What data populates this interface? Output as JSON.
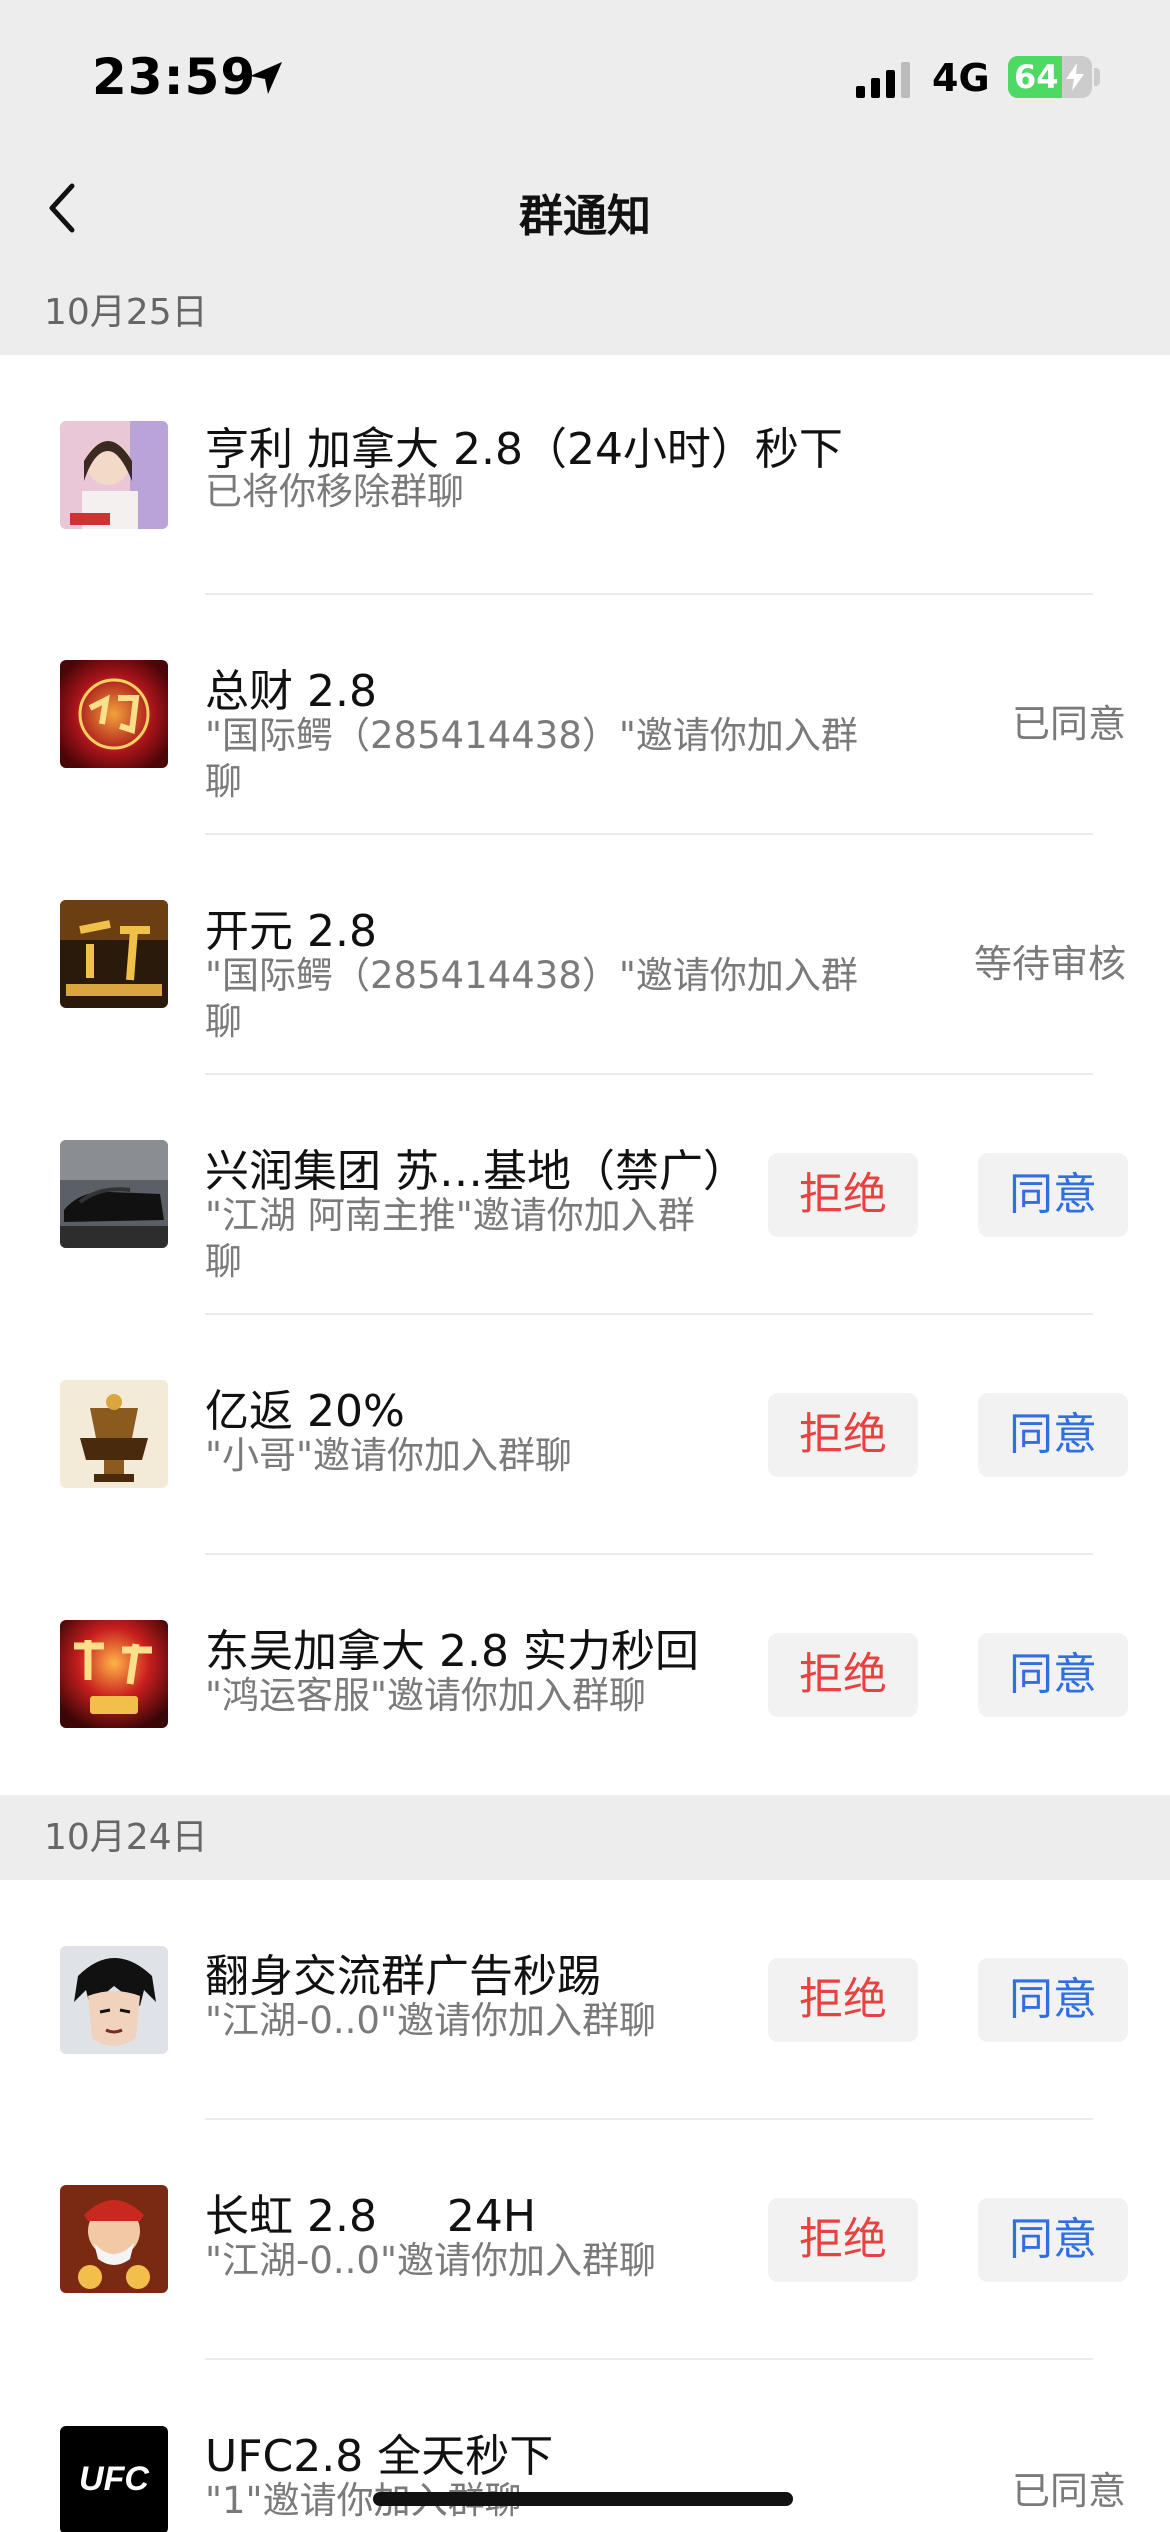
{
  "status_bar": {
    "time": "23:59",
    "network": "4G",
    "battery": "64",
    "battery_level": 0.64
  },
  "nav": {
    "title": "群通知"
  },
  "sections": [
    {
      "date": "10月25日",
      "items": [
        {
          "title": "亨利  加拿大 2.8（24小时）秒下",
          "desc": "已将你移除群聊",
          "status": "",
          "avatar": "woman-portrait"
        },
        {
          "title": "总财 2.8",
          "desc": "\"国际鳄（285414438）\"邀请你加入群\n聊",
          "status": "已同意",
          "avatar": "gold-logo"
        },
        {
          "title": "开元 2.8",
          "desc": "\"国际鳄（285414438）\"邀请你加入群\n聊",
          "status": "等待审核",
          "avatar": "kaiyuan-logo"
        },
        {
          "title": "兴润集团 苏…基地（禁广）",
          "desc": "\"江湖 阿南主推\"邀请你加入群\n聊",
          "reject": "拒绝",
          "accept": "同意",
          "avatar": "cars-photo"
        },
        {
          "title": "亿返 20%",
          "desc": "\"小哥\"邀请你加入群聊",
          "reject": "拒绝",
          "accept": "同意",
          "avatar": "trophy-logo"
        },
        {
          "title": "东吴加拿大 2.8 实力秒回",
          "desc": "\"鸿运客服\"邀请你加入群聊",
          "reject": "拒绝",
          "accept": "同意",
          "avatar": "dongwu-logo"
        }
      ]
    },
    {
      "date": "10月24日",
      "items": [
        {
          "title": "翻身交流群广告秒踢",
          "desc": "\"江湖-0..0\"邀请你加入群聊",
          "reject": "拒绝",
          "accept": "同意",
          "avatar": "anime-face"
        },
        {
          "title": "长虹 2.8     24H",
          "desc": "\"江湖-0..0\"邀请你加入群聊",
          "reject": "拒绝",
          "accept": "同意",
          "avatar": "fortune-god"
        },
        {
          "title": "UFC2.8 全天秒下",
          "desc": "\"1\"邀请你加入群聊",
          "status": "已同意",
          "avatar": "ufc-logo"
        }
      ]
    }
  ],
  "colors": {
    "reject": "#e64340",
    "accept": "#2f6fe0",
    "background": "#ededed"
  }
}
